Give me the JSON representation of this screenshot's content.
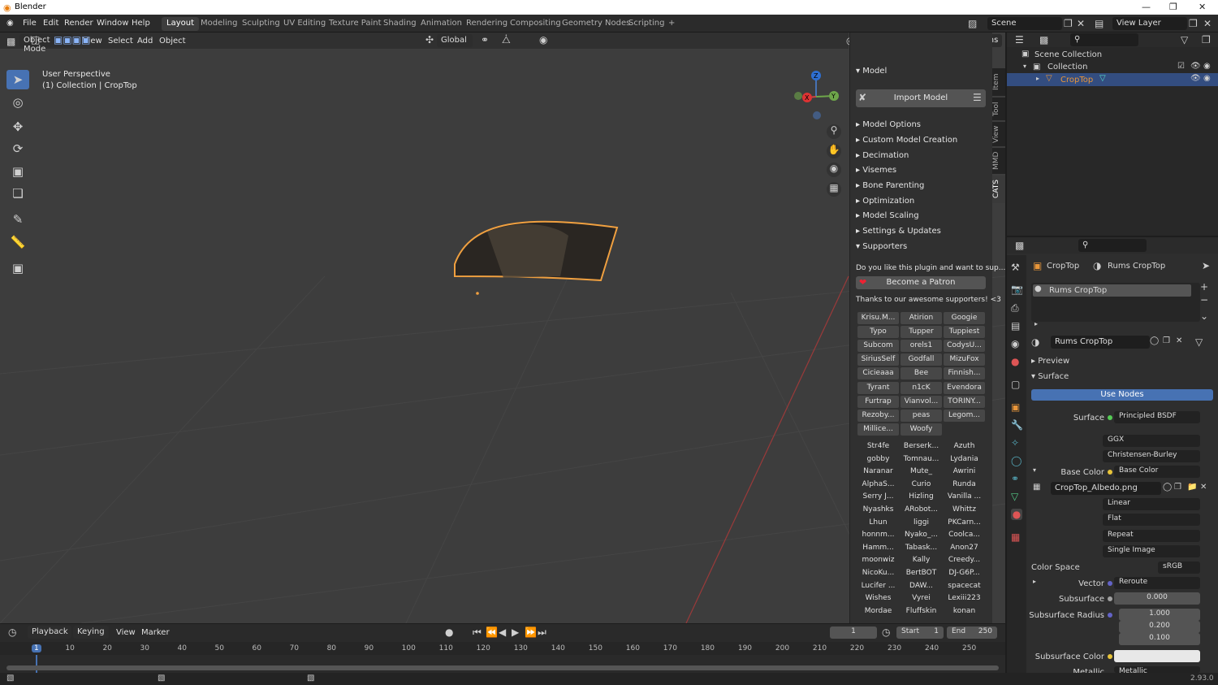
{
  "title": "Blender",
  "menus": [
    "File",
    "Edit",
    "Render",
    "Window",
    "Help"
  ],
  "workspaces": [
    "Layout",
    "Modeling",
    "Sculpting",
    "UV Editing",
    "Texture Paint",
    "Shading",
    "Animation",
    "Rendering",
    "Compositing",
    "Geometry Nodes",
    "Scripting"
  ],
  "scene": "Scene",
  "view_layer": "View Layer",
  "viewport": {
    "mode": "Object Mode",
    "menus": [
      "View",
      "Select",
      "Add",
      "Object"
    ],
    "orientation": "Global",
    "options": "Options",
    "perspective": "User Perspective",
    "collection_info": "(1) Collection | CropTop",
    "axes": {
      "x": "X",
      "y": "Y",
      "z": "Z"
    }
  },
  "npanel": {
    "tabs": [
      "Item",
      "Tool",
      "View",
      "MMD",
      "CATS"
    ],
    "model_header": "Model",
    "import_button": "Import Model",
    "sections": [
      "Model Options",
      "Custom Model Creation",
      "Decimation",
      "Visemes",
      "Bone Parenting",
      "Optimization",
      "Model Scaling",
      "Settings & Updates",
      "Supporters"
    ],
    "plugin_text": "Do you like this plugin and want to sup...",
    "patron_button": "Become a Patron",
    "thanks": "Thanks to our awesome supporters! <3",
    "supporters_boxed": [
      [
        "Krisu.M...",
        "Atirion",
        "Googie"
      ],
      [
        "Typo",
        "Tupper",
        "Tuppiest"
      ],
      [
        "Subcom",
        "orels1",
        "CodysU..."
      ],
      [
        "SiriusSelf",
        "Godfall",
        "MizuFox"
      ],
      [
        "Cicieaaa",
        "Bee",
        "Finnish..."
      ],
      [
        "Tyrant",
        "n1cK",
        "Evendora"
      ],
      [
        "Furtrap",
        "Vianvol...",
        "TORINY..."
      ],
      [
        "Rezoby...",
        "peas",
        "Legom..."
      ],
      [
        "Millice...",
        "Woofy",
        ""
      ]
    ],
    "supporters_plain": [
      [
        "Str4fe",
        "Berserk...",
        "Azuth"
      ],
      [
        "gobby",
        "Tomnau...",
        "Lydania"
      ],
      [
        "Naranar",
        "Mute_",
        "Awrini"
      ],
      [
        "AlphaS...",
        "Curio",
        "Runda"
      ],
      [
        "Serry J...",
        "Hizling",
        "Vanilla ..."
      ],
      [
        "Nyashks",
        "ARobot...",
        "Whittz"
      ],
      [
        "Lhun",
        "liggi",
        "PKCarn..."
      ],
      [
        "honnm...",
        "Nyako_...",
        "Coolca..."
      ],
      [
        "Hamm...",
        "Tabask...",
        "Anon27"
      ],
      [
        "moonwiz",
        "Kally",
        "Creedy..."
      ],
      [
        "NicoKu...",
        "BertBOT",
        "DJ-G6P..."
      ],
      [
        "Lucifer ...",
        "DAW...",
        "spacecat"
      ],
      [
        "Wishes",
        "Vyrei",
        "Lexiii223"
      ],
      [
        "Mordae",
        "Fluffskin",
        "konan"
      ]
    ]
  },
  "outliner": {
    "scene_collection": "Scene Collection",
    "collection": "Collection",
    "object": "CropTop"
  },
  "properties": {
    "object": "CropTop",
    "material": "Rums CropTop",
    "slot": "Rums CropTop",
    "material_field": "Rums CropTop",
    "preview": "Preview",
    "surface_section": "Surface",
    "use_nodes": "Use Nodes",
    "surface_label": "Surface",
    "surface_value": "Principled BSDF",
    "distribution": "GGX",
    "subsurface_method": "Christensen-Burley",
    "base_color_label": "Base Color",
    "base_color_value": "Base Color",
    "image": "CropTop_Albedo.png",
    "interp": "Linear",
    "projection": "Flat",
    "extension": "Repeat",
    "source": "Single Image",
    "color_space_label": "Color Space",
    "color_space": "sRGB",
    "vector_label": "Vector",
    "vector_value": "Reroute",
    "subsurface_label": "Subsurface",
    "subsurface_value": "0.000",
    "subsurface_radius_label": "Subsurface Radius",
    "radius": [
      "1.000",
      "0.200",
      "0.100"
    ],
    "subsurface_color_label": "Subsurface Color",
    "metallic_label": "Metallic",
    "metallic_value": "Metallic",
    "subsurface_color": "#e8e8e8"
  },
  "timeline": {
    "menus": [
      "Playback",
      "Keying",
      "View",
      "Marker"
    ],
    "current": "1",
    "start_label": "Start",
    "start": "1",
    "end_label": "End",
    "end": "250",
    "ticks": [
      "1",
      "10",
      "20",
      "30",
      "40",
      "50",
      "60",
      "70",
      "80",
      "90",
      "100",
      "110",
      "120",
      "130",
      "140",
      "150",
      "160",
      "170",
      "180",
      "190",
      "200",
      "210",
      "220",
      "230",
      "240",
      "250"
    ]
  },
  "version": "2.93.0",
  "colors": {
    "accent": "#4772b3",
    "selection": "#e8963a",
    "active_frame": "#4772b3"
  }
}
